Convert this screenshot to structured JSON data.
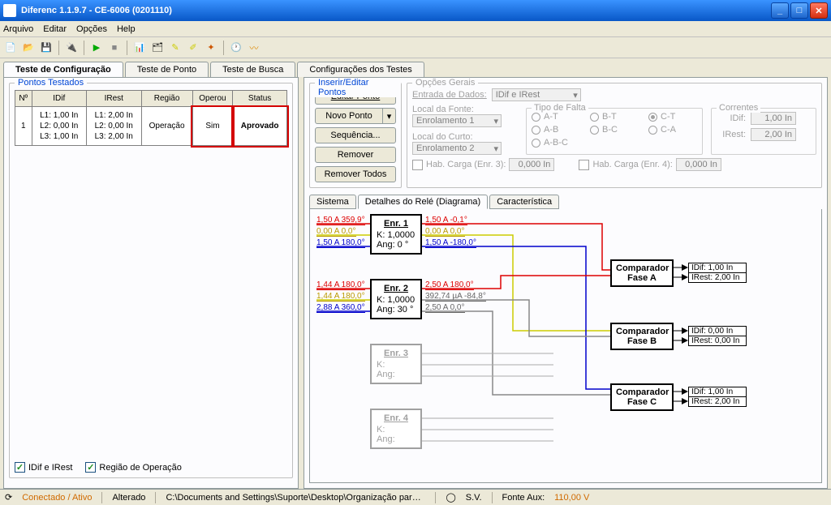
{
  "window": {
    "title": "Diferenc 1.1.9.7 - CE-6006 (0201110)"
  },
  "menu": {
    "arquivo": "Arquivo",
    "editar": "Editar",
    "opcoes": "Opções",
    "help": "Help"
  },
  "tabs": {
    "config": "Teste de Configuração",
    "ponto": "Teste de Ponto",
    "busca": "Teste de Busca",
    "conf": "Configurações dos Testes"
  },
  "left": {
    "title": "Pontos Testados",
    "headers": {
      "n": "Nº",
      "idif": "IDif",
      "irest": "IRest",
      "regiao": "Região",
      "operou": "Operou",
      "status": "Status"
    },
    "row": {
      "n": "1",
      "idif": "L1: 1,00 In\nL2: 0,00 In\nL3: 1,00 In",
      "irest": "L1: 2,00 In\nL2: 0,00 In\nL3: 2,00 In",
      "regiao": "Operação",
      "operou": "Sim",
      "status": "Aprovado"
    },
    "chk1": "IDif e IRest",
    "chk2": "Região de Operação"
  },
  "right": {
    "insert_title": "Inserir/Editar Pontos",
    "btns": {
      "editar": "Editar Ponto",
      "novo": "Novo Ponto",
      "seq": "Sequência...",
      "remover": "Remover",
      "removerTodos": "Remover Todos"
    },
    "opts": {
      "title": "Opções Gerais",
      "entrada_label": "Entrada de Dados:",
      "entrada_val": "IDif e IRest",
      "local_fonte": "Local da Fonte:",
      "fonte_val": "Enrolamento 1",
      "local_curto": "Local do Curto:",
      "curto_val": "Enrolamento 2",
      "tipo_falta": "Tipo de Falta",
      "radios": {
        "at": "A-T",
        "bt": "B-T",
        "ct": "C-T",
        "ab": "A-B",
        "bc": "B-C",
        "ca": "C-A",
        "abc": "A-B-C"
      },
      "correntes": "Correntes",
      "idif_l": "IDif:",
      "idif_v": "1,00 In",
      "irest_l": "IRest:",
      "irest_v": "2,00 In",
      "hab3_l": "Hab. Carga (Enr. 3):",
      "hab3_v": "0,000 In",
      "hab4_l": "Hab. Carga (Enr. 4):",
      "hab4_v": "0,000 In"
    },
    "subtabs": {
      "sistema": "Sistema",
      "detalhes": "Detalhes do Relé (Diagrama)",
      "carac": "Característica"
    },
    "diag": {
      "enr1": {
        "title": "Enr. 1",
        "k": "K: 1,0000",
        "ang": "Ang: 0 °",
        "l1": "1,50 A 359,9°",
        "l2": "0,00 A 0,0°",
        "l3": "1,50 A 180,0°",
        "r1": "1,50 A -0,1°",
        "r2": "0,00 A 0,0°",
        "r3": "1,50 A -180,0°"
      },
      "enr2": {
        "title": "Enr. 2",
        "k": "K: 1,0000",
        "ang": "Ang: 30 °",
        "l1": "1,44 A 180,0°",
        "l2": "1,44 A 180,0°",
        "l3": "2,88 A 360,0°",
        "r1": "2,50 A 180,0°",
        "r2": "392,74 µA -84,8°",
        "r3": "2,50 A 0,0°"
      },
      "enr3": {
        "title": "Enr. 3",
        "k": "K:",
        "ang": "Ang:"
      },
      "enr4": {
        "title": "Enr. 4",
        "k": "K:",
        "ang": "Ang:"
      },
      "compA": "Comparador\nFase A",
      "compB": "Comparador\nFase B",
      "compC": "Comparador\nFase C",
      "outA1": "IDif: 1,00 In",
      "outA2": "IRest: 2,00 In",
      "outB1": "IDif: 0,00 In",
      "outB2": "IRest: 0,00 In",
      "outC1": "IDif: 1,00 In",
      "outC2": "IRest: 2,00 In"
    }
  },
  "status": {
    "conectado": "Conectado / Ativo",
    "alterado": "Alterado",
    "path": "C:\\Documents and Settings\\Suporte\\Desktop\\Organização para An.",
    "sv": "S.V.",
    "fonte": "Fonte Aux:",
    "fonte_v": "110,00 V"
  }
}
